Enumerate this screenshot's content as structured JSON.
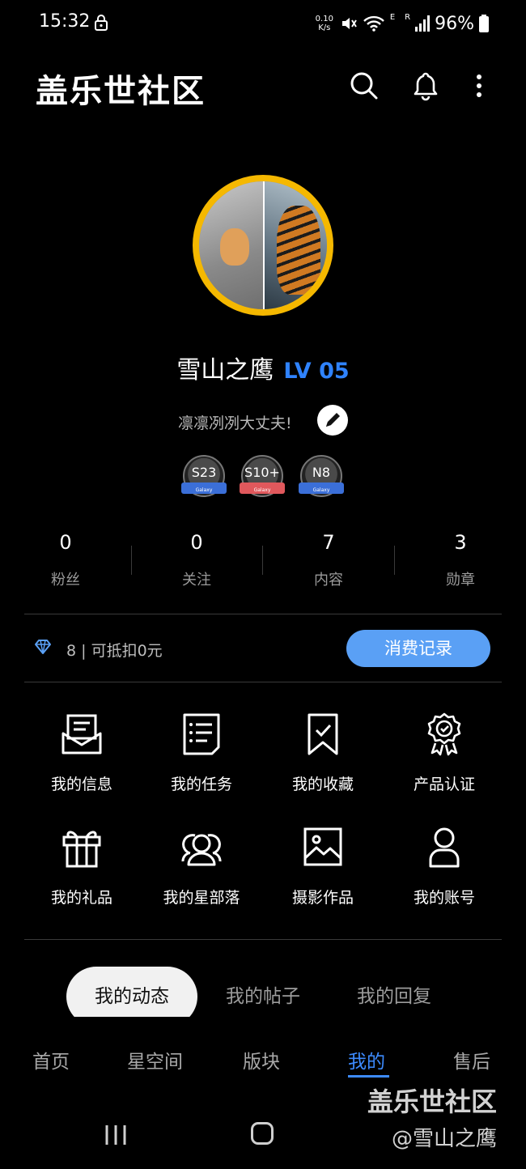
{
  "status_bar": {
    "time": "15:32",
    "net_speed_value": "0.10",
    "net_speed_unit": "K/s",
    "net_type_1": "E",
    "net_type_2": "R",
    "battery": "96%"
  },
  "app_bar": {
    "title": "盖乐世社区",
    "icons": [
      "search-icon",
      "bell-icon",
      "more-vertical-icon"
    ]
  },
  "profile": {
    "name": "雪山之鹰",
    "level": "LV 05",
    "signature": "凛凛冽冽大丈夫!",
    "badges": [
      {
        "label": "S23",
        "sub": "Galaxy",
        "color": "#3b6fd8"
      },
      {
        "label": "S10+",
        "sub": "Galaxy",
        "color": "#e0585c"
      },
      {
        "label": "N8",
        "sub": "Galaxy",
        "color": "#3b6fd8"
      }
    ]
  },
  "stats": [
    {
      "value": "0",
      "label": "粉丝"
    },
    {
      "value": "0",
      "label": "关注"
    },
    {
      "value": "7",
      "label": "内容"
    },
    {
      "value": "3",
      "label": "勋章"
    }
  ],
  "points": {
    "text": "8 | 可抵扣0元",
    "button": "消费记录"
  },
  "menu": [
    {
      "label": "我的信息",
      "icon": "message-envelope-icon"
    },
    {
      "label": "我的任务",
      "icon": "task-list-icon"
    },
    {
      "label": "我的收藏",
      "icon": "bookmark-check-icon"
    },
    {
      "label": "产品认证",
      "icon": "certified-badge-icon"
    },
    {
      "label": "我的礼品",
      "icon": "gift-icon"
    },
    {
      "label": "我的星部落",
      "icon": "group-icon"
    },
    {
      "label": "摄影作品",
      "icon": "image-icon"
    },
    {
      "label": "我的账号",
      "icon": "person-icon"
    }
  ],
  "tabs": [
    {
      "label": "我的动态",
      "active": true
    },
    {
      "label": "我的帖子",
      "active": false
    },
    {
      "label": "我的回复",
      "active": false
    }
  ],
  "bottom_nav": [
    {
      "label": "首页",
      "active": false
    },
    {
      "label": "星空间",
      "active": false
    },
    {
      "label": "版块",
      "active": false
    },
    {
      "label": "我的",
      "active": true
    },
    {
      "label": "售后",
      "active": false
    }
  ],
  "watermark": {
    "line1": "盖乐世社区",
    "line2": "@雪山之鹰"
  },
  "colors": {
    "background": "#000000",
    "accent_blue": "#3d8bff",
    "button_blue": "#5aa0f5",
    "avatar_ring": "#f5b800"
  }
}
